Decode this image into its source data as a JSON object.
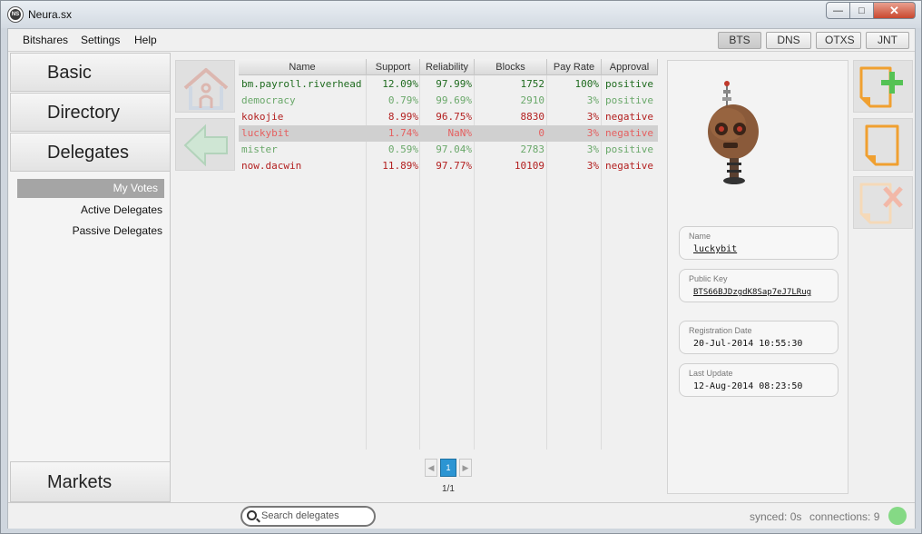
{
  "window": {
    "title": "Neura.sx"
  },
  "menu": {
    "items": [
      "Bitshares",
      "Settings",
      "Help"
    ]
  },
  "networks": [
    {
      "label": "BTS",
      "selected": true
    },
    {
      "label": "DNS",
      "selected": false
    },
    {
      "label": "OTXS",
      "selected": false
    },
    {
      "label": "JNT",
      "selected": false
    }
  ],
  "sidebar": {
    "tabs": [
      "Basic",
      "Directory",
      "Delegates"
    ],
    "sub_items": [
      "My Votes",
      "Active Delegates",
      "Passive Delegates"
    ],
    "selected_sub": "My Votes",
    "bottom_tab": "Markets"
  },
  "table": {
    "headers": [
      "Name",
      "Support",
      "Reliability",
      "Blocks",
      "Pay Rate",
      "Approval"
    ],
    "rows": [
      {
        "name": "bm.payroll.riverhead",
        "support": "12.09%",
        "reliability": "97.99%",
        "blocks": "1752",
        "pay_rate": "100%",
        "approval": "positive"
      },
      {
        "name": "democracy",
        "support": "0.79%",
        "reliability": "99.69%",
        "blocks": "2910",
        "pay_rate": "3%",
        "approval": "positive"
      },
      {
        "name": "kokojie",
        "support": "8.99%",
        "reliability": "96.75%",
        "blocks": "8830",
        "pay_rate": "3%",
        "approval": "negative"
      },
      {
        "name": "luckybit",
        "support": "1.74%",
        "reliability": "NaN%",
        "blocks": "0",
        "pay_rate": "3%",
        "approval": "negative"
      },
      {
        "name": "mister",
        "support": "0.59%",
        "reliability": "97.04%",
        "blocks": "2783",
        "pay_rate": "3%",
        "approval": "positive"
      },
      {
        "name": "now.dacwin",
        "support": "11.89%",
        "reliability": "97.77%",
        "blocks": "10109",
        "pay_rate": "3%",
        "approval": "negative"
      }
    ],
    "selected_row": 3
  },
  "pager": {
    "current": "1",
    "info": "1/1"
  },
  "detail": {
    "name_label": "Name",
    "name_value": "luckybit",
    "key_label": "Public Key",
    "key_value": "BTS66BJDzgdK8Sap7eJ7LRug",
    "reg_label": "Registration Date",
    "reg_value": "20-Jul-2014 10:55:30",
    "update_label": "Last Update",
    "update_value": "12-Aug-2014 08:23:50"
  },
  "status": {
    "search_placeholder": "Search delegates",
    "synced": "synced: 0s",
    "connections": "connections: 9",
    "connection_color": "#85d985"
  }
}
